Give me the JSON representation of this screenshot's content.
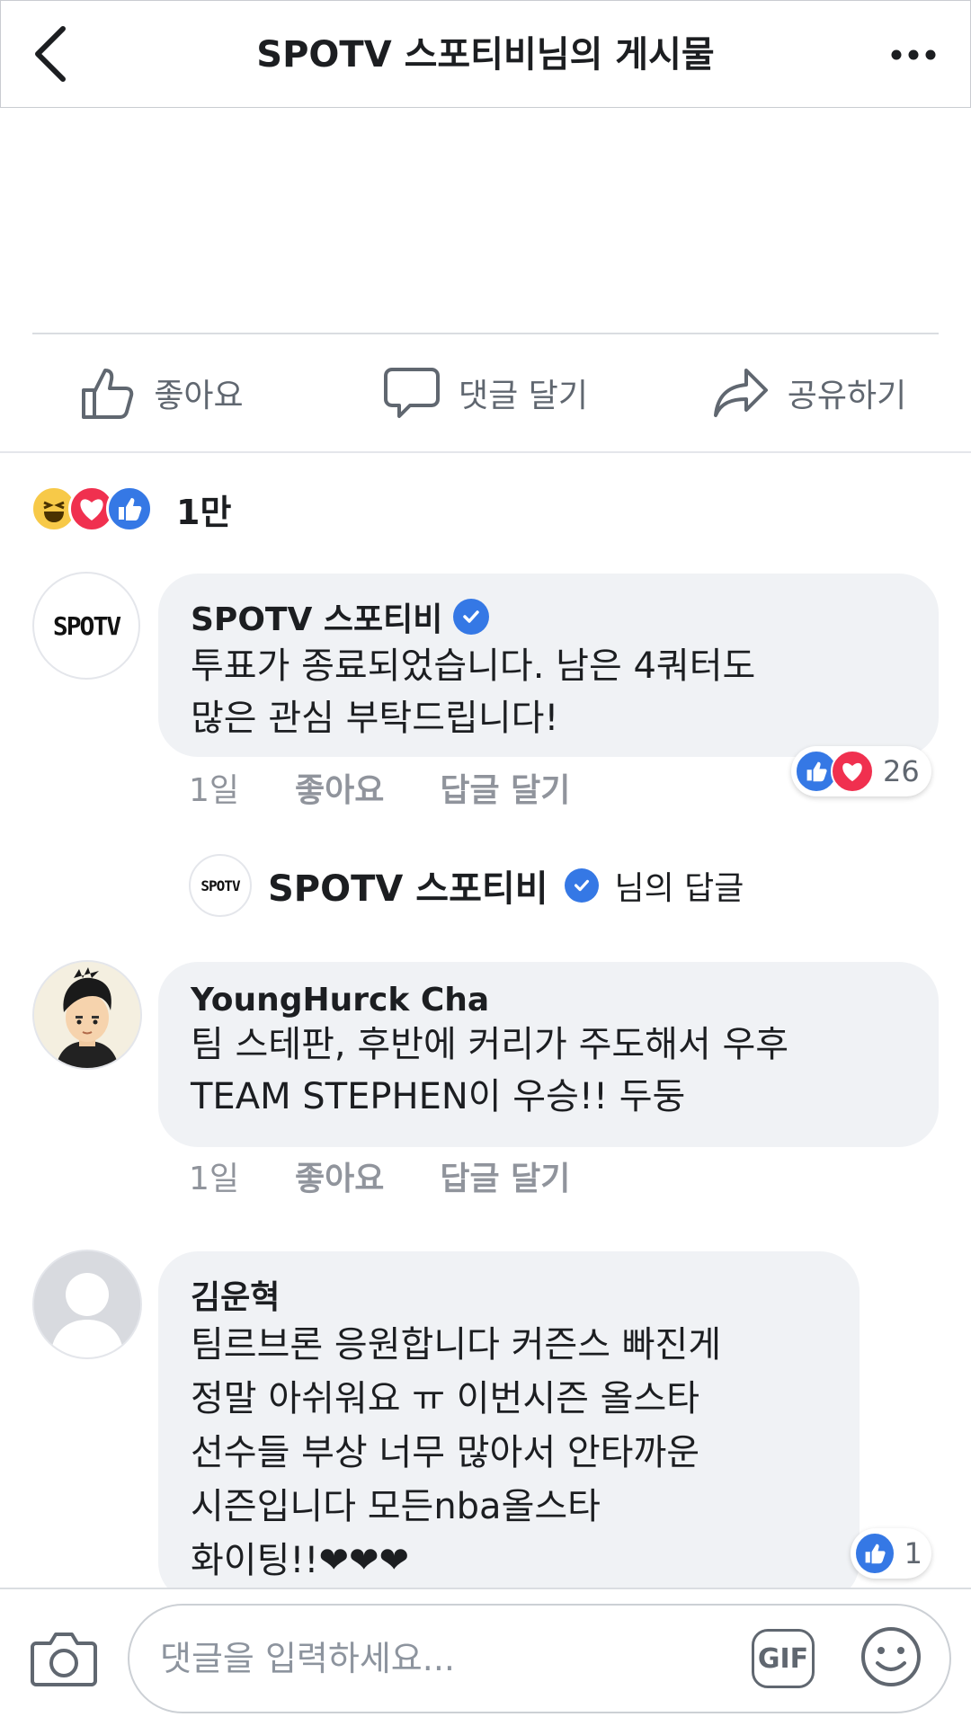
{
  "header": {
    "title": "SPOTV 스포티비님의 게시물"
  },
  "actions": {
    "like_label": "좋아요",
    "comment_label": "댓글 달기",
    "share_label": "공유하기"
  },
  "reactions_summary": {
    "types": [
      "haha",
      "love",
      "like"
    ],
    "count": "1만"
  },
  "comments": [
    {
      "author": "SPOTV 스포티비",
      "verified": true,
      "avatar_text": "SPOTV",
      "text": "투표가 종료되었습니다. 남은 4쿼터도\n많은 관심 부탁드립니다!",
      "time": "1일",
      "like_label": "좋아요",
      "reply_label": "답글 달기",
      "reactions": [
        "like",
        "love"
      ],
      "reaction_count": "26"
    },
    {
      "author": "YoungHurck Cha",
      "verified": false,
      "text": "팀 스테판, 후반에 커리가 주도해서 우후\nTEAM STEPHEN이 우승!! 두둥",
      "time": "1일",
      "like_label": "좋아요",
      "reply_label": "답글 달기"
    },
    {
      "author": "김운혁",
      "verified": false,
      "text": "팀르브론 응원합니다 커즌스 빠진게\n정말 아쉬워요 ㅠ 이번시즌 올스타\n선수들 부상 너무 많아서 안타까운\n시즌입니다 모든nba올스타\n화이팅!!❤❤❤",
      "reactions": [
        "like"
      ],
      "reaction_count": "1"
    }
  ],
  "reply_preview": {
    "avatar_text": "SPOTV",
    "author": "SPOTV 스포티비",
    "suffix": "님의 답글"
  },
  "composer": {
    "placeholder": "댓글을 입력하세요...",
    "gif_label": "GIF"
  },
  "colors": {
    "brand_blue": "#3578e5",
    "love_red": "#f0304f",
    "haha_yellow": "#f7c948",
    "bubble_bg": "#f0f2f5",
    "meta_gray": "#90949c"
  }
}
